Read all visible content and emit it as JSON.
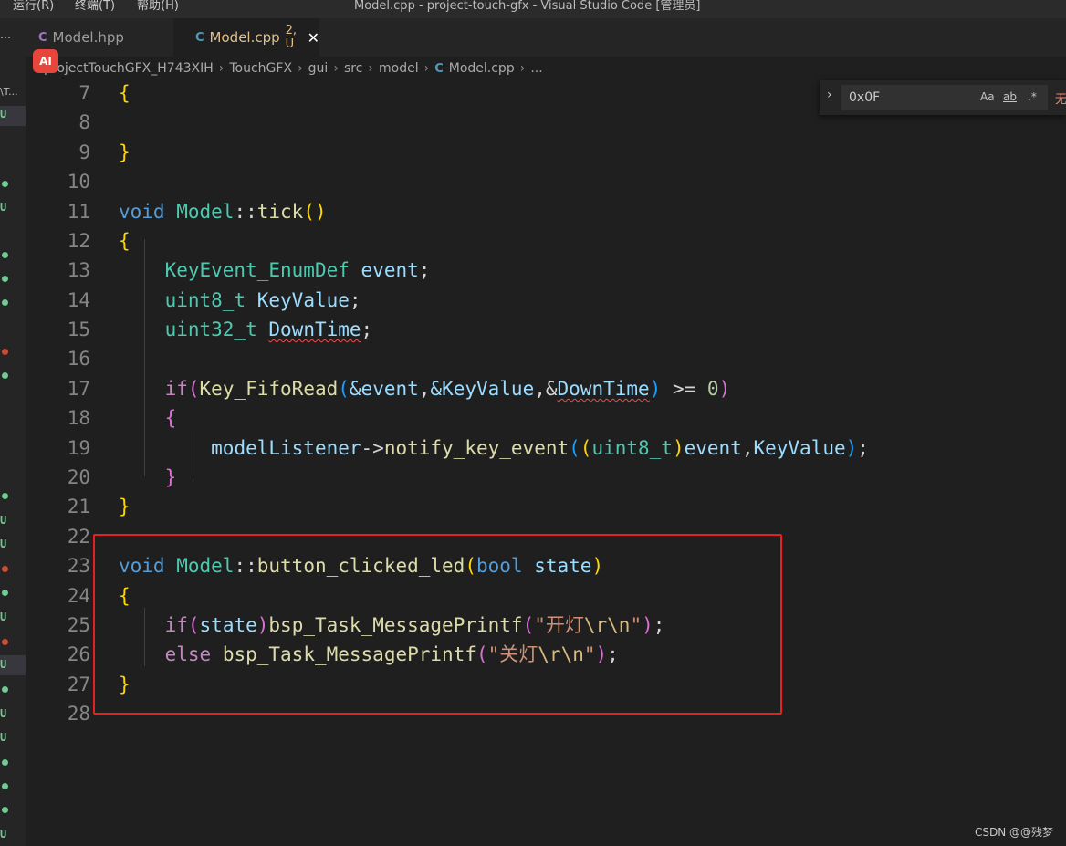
{
  "window": {
    "title": "Model.cpp - project-touch-gfx - Visual Studio Code [管理员]",
    "menu": [
      "运行(R)",
      "终端(T)",
      "帮助(H)"
    ]
  },
  "left_strip": {
    "path_fragment": "\\T...",
    "untracked_marker": "U"
  },
  "tabs": [
    {
      "label": "Model.hpp",
      "icon": "c-plus-plus-icon",
      "active": false
    },
    {
      "label": "Model.cpp",
      "icon": "c-plus-plus-icon",
      "active": true,
      "badge": "2, U",
      "close": "✕"
    }
  ],
  "breadcrumb": {
    "items": [
      "projectTouchGFX_H743XIH",
      "TouchGFX",
      "gui",
      "src",
      "model",
      "Model.cpp",
      "..."
    ],
    "separator": "›"
  },
  "ai_badge": "AI",
  "find_widget": {
    "value": "0x0F",
    "options": [
      "Aa",
      "ab",
      ".*"
    ],
    "result": "无"
  },
  "editor": {
    "line_numbers": [
      "7",
      "8",
      "9",
      "10",
      "11",
      "12",
      "13",
      "14",
      "15",
      "16",
      "17",
      "18",
      "19",
      "20",
      "21",
      "22",
      "23",
      "24",
      "25",
      "26",
      "27",
      "28"
    ],
    "code": {
      "l7_open": "{",
      "l9_close": "}",
      "l11_void": "void",
      "l11_class": "Model",
      "l11_sep": "::",
      "l11_fn": "tick",
      "l11_parens": "()",
      "l12_open": "{",
      "l13_type": "KeyEvent_EnumDef",
      "l13_var": "event",
      "l13_semi": ";",
      "l14_type": "uint8_t",
      "l14_var": "KeyValue",
      "l14_semi": ";",
      "l15_type": "uint32_t",
      "l15_var": "DownTime",
      "l15_semi": ";",
      "l17_if": "if",
      "l17_po": "(",
      "l17_fn": "Key_FifoRead",
      "l17_pi": "(",
      "l17_a1": "&event",
      "l17_c1": ",",
      "l17_a2": "&KeyValue",
      "l17_c2": ",&",
      "l17_a3": "DownTime",
      "l17_pic": ")",
      "l17_op": " >= ",
      "l17_num": "0",
      "l17_pc": ")",
      "l18_open": "{",
      "l19_obj": "modelListener",
      "l19_arrow": "->",
      "l19_fn": "notify_key_event",
      "l19_p1": "(",
      "l19_p2": "(",
      "l19_type": "uint8_t",
      "l19_p3": ")",
      "l19_a1": "event",
      "l19_c1": ",",
      "l19_a2": "KeyValue",
      "l19_p4": ")",
      "l19_semi": ";",
      "l20_close": "}",
      "l21_close": "}",
      "l23_void": "void",
      "l23_class": "Model",
      "l23_sep": "::",
      "l23_fn": "button_clicked_led",
      "l23_po": "(",
      "l23_bool": "bool",
      "l23_var": "state",
      "l23_pc": ")",
      "l24_open": "{",
      "l25_if": "if",
      "l25_po": "(",
      "l25_var": "state",
      "l25_pc": ")",
      "l25_fn": "bsp_Task_MessagePrintf",
      "l25_pi": "(",
      "l25_str": "\"开灯",
      "l25_esc": "\\r\\n",
      "l25_strend": "\"",
      "l25_pic": ")",
      "l25_semi": ";",
      "l26_else": "else",
      "l26_fn": "bsp_Task_MessagePrintf",
      "l26_pi": "(",
      "l26_str": "\"关灯",
      "l26_esc": "\\r\\n",
      "l26_strend": "\"",
      "l26_pic": ")",
      "l26_semi": ";",
      "l27_close": "}"
    }
  },
  "watermark": "CSDN @@残梦"
}
